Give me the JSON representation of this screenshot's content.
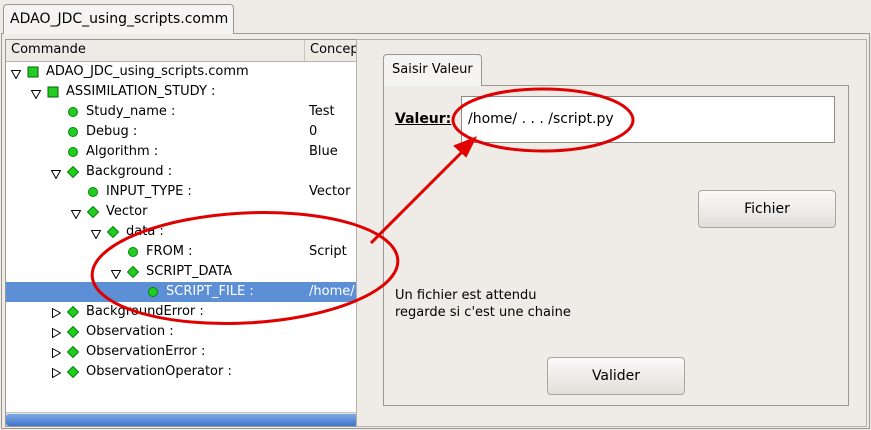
{
  "window": {
    "tab_title": "ADAO_JDC_using_scripts.comm"
  },
  "tree": {
    "columns": [
      "Commande",
      "Concept"
    ],
    "rows": [
      {
        "label": "ADAO_JDC_using_scripts.comm",
        "value": "",
        "icon": "green-square-icon",
        "toggle": "open"
      },
      {
        "label": "ASSIMILATION_STUDY :",
        "value": "",
        "icon": "green-square-icon",
        "toggle": "open"
      },
      {
        "label": "Study_name :",
        "value": "Test",
        "icon": "green-circle-icon",
        "toggle": ""
      },
      {
        "label": "Debug :",
        "value": "0",
        "icon": "green-circle-icon",
        "toggle": ""
      },
      {
        "label": "Algorithm :",
        "value": "Blue",
        "icon": "green-circle-icon",
        "toggle": ""
      },
      {
        "label": "Background :",
        "value": "",
        "icon": "green-diamond-icon",
        "toggle": "open"
      },
      {
        "label": "INPUT_TYPE :",
        "value": "Vector",
        "icon": "green-circle-icon",
        "toggle": ""
      },
      {
        "label": "Vector",
        "value": "",
        "icon": "green-diamond-icon",
        "toggle": "open"
      },
      {
        "label": "data :",
        "value": "",
        "icon": "green-diamond-icon",
        "toggle": "open"
      },
      {
        "label": "FROM :",
        "value": "Script",
        "icon": "green-circle-icon",
        "toggle": ""
      },
      {
        "label": "SCRIPT_DATA",
        "value": "",
        "icon": "green-diamond-icon",
        "toggle": "open"
      },
      {
        "label": "SCRIPT_FILE :",
        "value": "/home/",
        "icon": "green-circle-icon",
        "toggle": "",
        "selected": true
      },
      {
        "label": "BackgroundError :",
        "value": "",
        "icon": "green-diamond-icon",
        "toggle": "closed"
      },
      {
        "label": "Observation :",
        "value": "",
        "icon": "green-diamond-icon",
        "toggle": "closed"
      },
      {
        "label": "ObservationError :",
        "value": "",
        "icon": "green-diamond-icon",
        "toggle": "closed"
      },
      {
        "label": "ObservationOperator :",
        "value": "",
        "icon": "green-diamond-icon",
        "toggle": "closed"
      }
    ]
  },
  "editor": {
    "tab_label": "Saisir Valeur",
    "field_label": "Valeur:",
    "field_value": "/home/ . . . /script.py",
    "fichier_button": "Fichier",
    "message_line1": "Un fichier est attendu",
    "message_line2": "regarde si c'est une chaine",
    "valider_button": "Valider"
  },
  "colors": {
    "selection": "#5d8fd6",
    "icon_green": "#22cc22",
    "annotation_red": "#e00000"
  }
}
